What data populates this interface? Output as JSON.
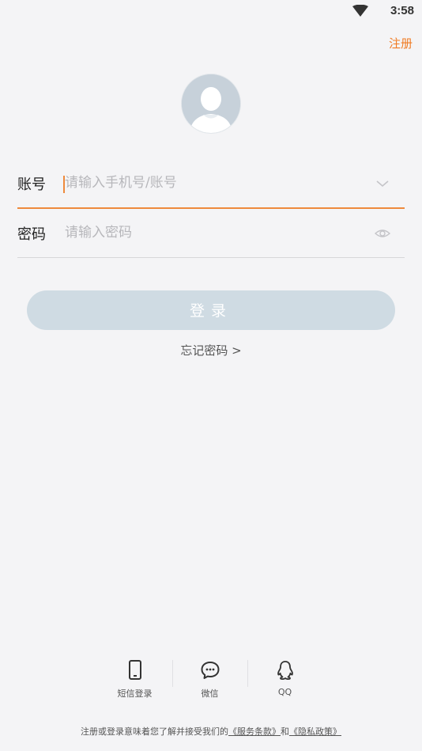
{
  "status_bar": {
    "time": "3:58"
  },
  "header": {
    "register_label": "注册"
  },
  "form": {
    "account": {
      "label": "账号",
      "placeholder": "请输入手机号/账号",
      "value": ""
    },
    "password": {
      "label": "密码",
      "placeholder": "请输入密码",
      "value": ""
    },
    "login_label": "登录",
    "forgot_label": "忘记密码 >"
  },
  "social": {
    "items": [
      {
        "label": "短信登录",
        "icon": "phone-icon"
      },
      {
        "label": "微信",
        "icon": "wechat-icon"
      },
      {
        "label": "QQ",
        "icon": "qq-icon"
      }
    ]
  },
  "agreement": {
    "prefix": "注册或登录意味着您了解并接受我们的",
    "terms": "《服务条款》",
    "and": "和",
    "privacy": "《隐私政策》"
  },
  "colors": {
    "accent": "#f07b23",
    "login_button": "#cfdbe3",
    "background": "#f4f4f6"
  }
}
